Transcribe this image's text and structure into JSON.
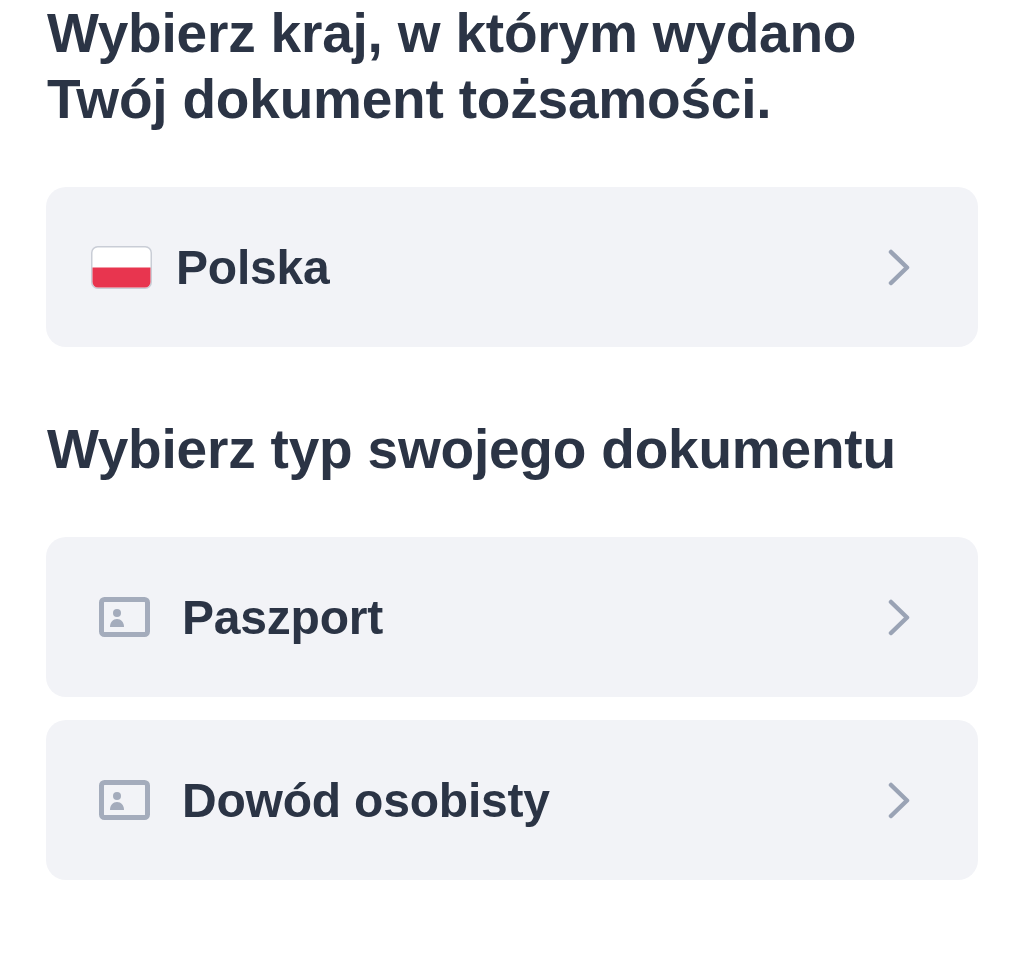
{
  "country_section": {
    "title": "Wybierz kraj, w którym wydano Twój dokument tożsamości.",
    "selector": {
      "label": "Polska"
    }
  },
  "document_section": {
    "title": "Wybierz typ swojego dokumentu",
    "options": [
      {
        "label": "Paszport"
      },
      {
        "label": "Dowód osobisty"
      }
    ]
  }
}
